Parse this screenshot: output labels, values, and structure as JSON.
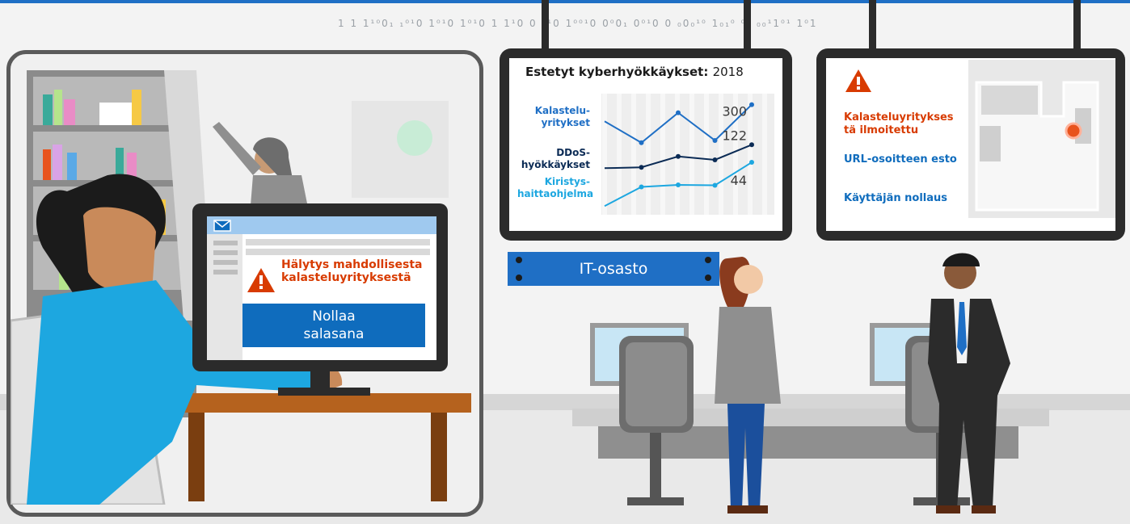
{
  "binary_stream": "1 1 1¹⁰0₁ ₁⁰¹0 1⁰¹0 1⁰¹0 1 1¹0 0  ⁰¹0 1⁰⁰¹0 0⁰0₁ 0⁰¹0 0   ₀0₀¹⁰  1₀₁⁰ ⁰¹  ₀₀¹1⁰¹ 1⁰1",
  "email_app": {
    "alert_text": "Hälytys mahdollisesta kalasteluyrityksestä",
    "reset_button": "Nollaa salasana",
    "mail_icon": "mail-icon",
    "warning_icon": "warning-icon"
  },
  "dept_sign": "IT-osasto",
  "chart_data": {
    "type": "line",
    "title": "Estetyt kyberhyökkäykset",
    "title_year": "2018",
    "series": [
      {
        "name": "Kalastelu-yritykset",
        "color": "#1f6fc5",
        "values": [
          226,
          131,
          264,
          141,
          300
        ],
        "end_label": "300"
      },
      {
        "name": "DDoS-hyökkäykset",
        "color": "#0b2b55",
        "values": [
          18,
          22,
          70,
          55,
          122
        ],
        "end_label": "122"
      },
      {
        "name": "Kiristys-haittaohjelma",
        "color": "#1da7e0",
        "values": [
          -150,
          -65,
          -56,
          -58,
          44
        ],
        "end_label": "44"
      }
    ],
    "x": [
      1,
      2,
      3,
      4,
      5
    ],
    "ylim": [
      -160,
      320
    ],
    "grid": true
  },
  "action_panel": {
    "warning_icon": "warning-icon",
    "items": [
      {
        "text": "Kalasteluyritykses tä ilmoitettu",
        "color": "#d83b01"
      },
      {
        "text": "URL-osoitteen esto",
        "color": "#0f6cbd"
      },
      {
        "text": "Käyttäjän nollaus",
        "color": "#0f6cbd"
      }
    ]
  },
  "colors": {
    "brand": "#1f6fc5",
    "alert": "#d83b01",
    "monitor": "#2b2b2b"
  }
}
